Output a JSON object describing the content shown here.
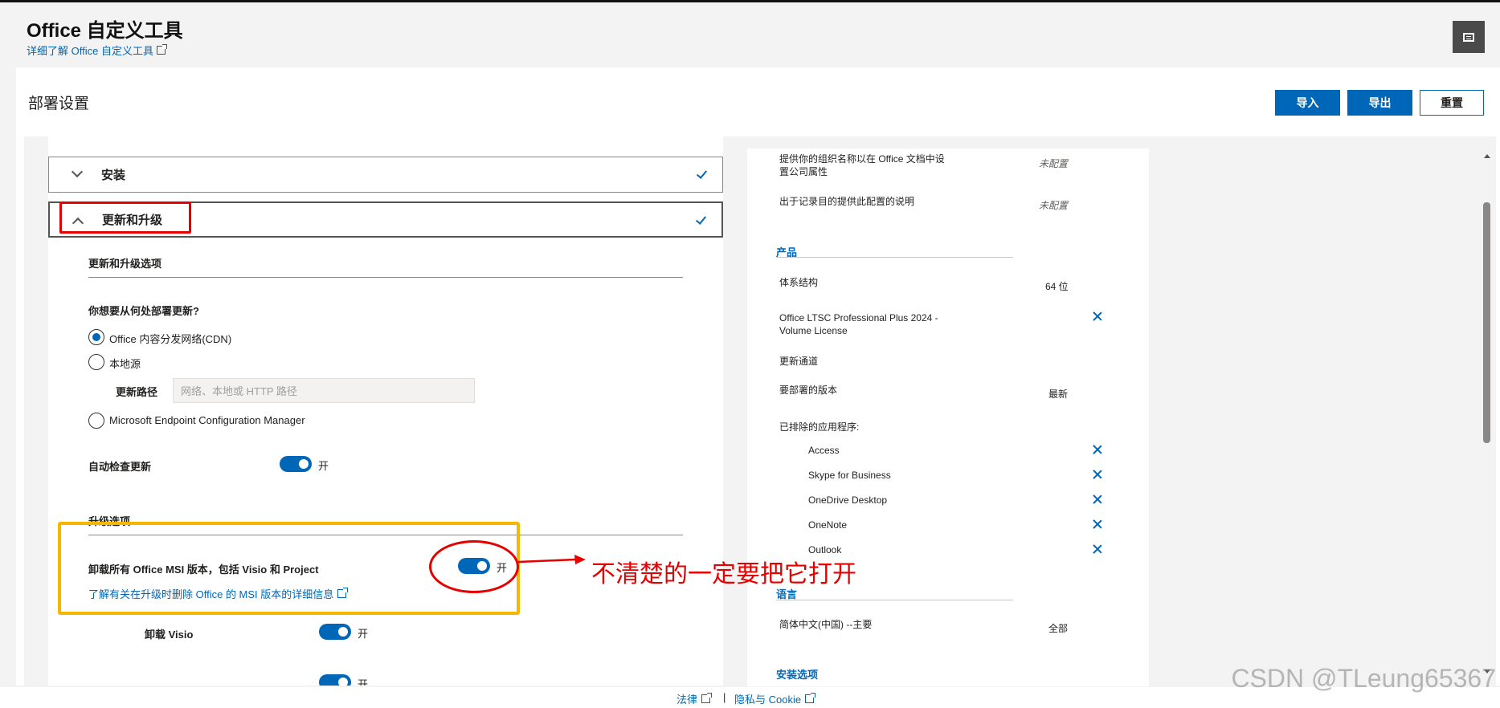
{
  "header": {
    "app_title": "Office 自定义工具",
    "learn_link": "详细了解 Office 自定义工具"
  },
  "page": {
    "section_title": "部署设置",
    "import_label": "导入",
    "export_label": "导出",
    "reset_label": "重置"
  },
  "accordion": {
    "install_label": "安装",
    "update_label": "更新和升级"
  },
  "update_options": {
    "heading": "更新和升级选项",
    "question": "你想要从何处部署更新?",
    "radio_cdn": "Office 内容分发网络(CDN)",
    "radio_local": "本地源",
    "update_path_label": "更新路径",
    "update_path_placeholder": "网络、本地或 HTTP 路径",
    "radio_mecm": "Microsoft Endpoint Configuration Manager",
    "auto_check_label": "自动检查更新",
    "auto_check_state": "开",
    "upgrade_heading": "升级选项",
    "remove_msi_label": "卸载所有 Office MSI 版本，包括 Visio 和 Project",
    "remove_msi_state": "开",
    "remove_msi_link": "了解有关在升级时删除 Office 的 MSI 版本的详细信息",
    "remove_visio_label": "卸载 Visio",
    "remove_visio_state": "开",
    "partial_toggle_state": "开"
  },
  "summary": {
    "org_label": "提供你的组织名称以在 Office 文档中设置公司属性",
    "org_label_line1": "提供你的组织名称以在 Office 文档中设",
    "org_label_line2": "置公司属性",
    "org_value": "未配置",
    "desc_label": "出于记录目的提供此配置的说明",
    "desc_value": "未配置",
    "products_heading": "产品",
    "arch_label": "体系结构",
    "arch_value": "64 位",
    "product_line1": "Office LTSC Professional Plus 2024 -",
    "product_line2": "Volume License",
    "channel_label": "更新通道",
    "version_label": "要部署的版本",
    "version_value": "最新",
    "excluded_label": "已排除的应用程序:",
    "excluded_apps": [
      "Access",
      "Skype for Business",
      "OneDrive Desktop",
      "OneNote",
      "Outlook"
    ],
    "language_heading": "语言",
    "language_label": "简体中文(中国) --主要",
    "language_value": "全部",
    "install_options_heading": "安装选项"
  },
  "footer": {
    "legal": "法律",
    "separator": "|",
    "privacy": "隐私与 Cookie"
  },
  "annotation": {
    "note": "不清楚的一定要把它打开"
  },
  "watermark": "CSDN @TLeung65367",
  "colors": {
    "accent": "#0067b8",
    "annotation_red": "#e60000",
    "annotation_yellow": "#f5b800"
  }
}
